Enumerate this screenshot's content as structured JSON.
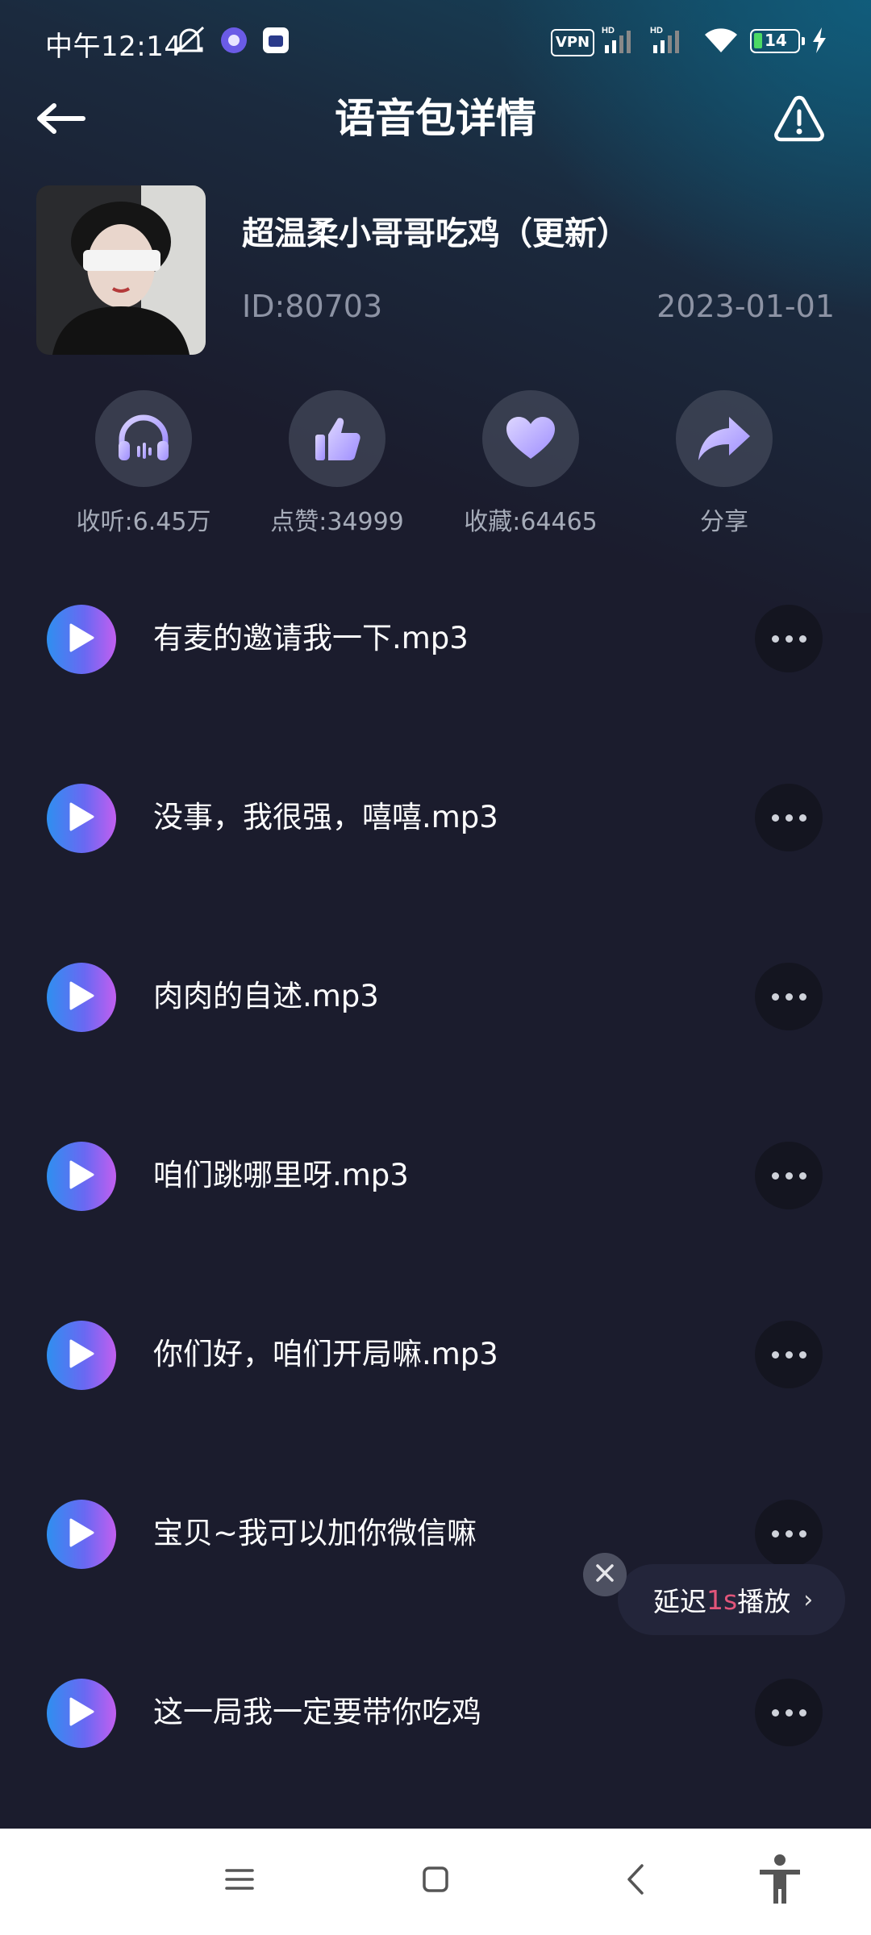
{
  "status_bar": {
    "time": "中午12:14",
    "vpn": "VPN",
    "battery_level": "14",
    "icons": [
      "mute-icon",
      "app-notification-icon",
      "app-notification-icon-2",
      "signal-hd-icon",
      "signal-hd-icon-2",
      "wifi-icon",
      "battery-icon",
      "charging-icon"
    ]
  },
  "header": {
    "title": "语音包详情",
    "back_icon": "arrow-left-icon",
    "report_icon": "warning-icon"
  },
  "pack": {
    "name": "超温柔小哥哥吃鸡（更新）",
    "id": "ID:80703",
    "date": "2023-01-01"
  },
  "stats": [
    {
      "icon": "headphones-icon",
      "label": "收听:6.45万"
    },
    {
      "icon": "thumbs-up-icon",
      "label": "点赞:34999"
    },
    {
      "icon": "heart-icon",
      "label": "收藏:64465"
    },
    {
      "icon": "share-icon",
      "label": "分享"
    }
  ],
  "voices": [
    {
      "title": "有麦的邀请我一下.mp3"
    },
    {
      "title": "没事，我很强，嘻嘻.mp3"
    },
    {
      "title": "肉肉的自述.mp3"
    },
    {
      "title": "咱们跳哪里呀.mp3"
    },
    {
      "title": "你们好，咱们开局嘛.mp3"
    },
    {
      "title": "宝贝~我可以加你微信嘛"
    },
    {
      "title": "这一局我一定要带你吃鸡"
    }
  ],
  "delay_popup": {
    "prefix": "延迟",
    "highlight": "1s",
    "suffix": "播放",
    "chevron": "›"
  },
  "colors": {
    "background": "#1b1c2d",
    "accent_gradient": [
      "#2f8ff0",
      "#c25ff0"
    ],
    "highlight": "#e2557a",
    "muted_text": "#8d93a4"
  }
}
